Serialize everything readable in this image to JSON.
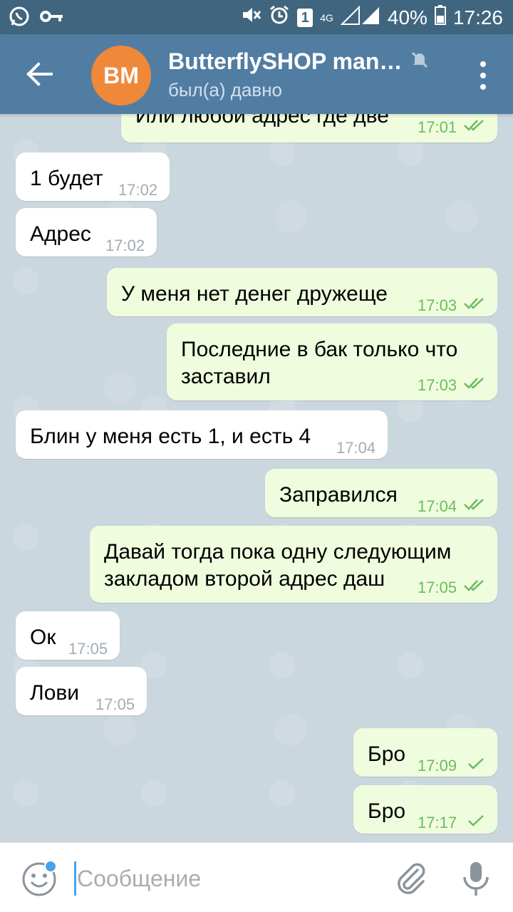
{
  "status_bar": {
    "battery": "40%",
    "time": "17:26",
    "sim_badge": "1",
    "network": "4G"
  },
  "header": {
    "avatar_initials": "BM",
    "title": "ButterflySHOP man…",
    "subtitle": "был(а) давно"
  },
  "messages": [
    {
      "side": "out",
      "text": "Или любой адрес где две",
      "time": "17:01",
      "status": "read"
    },
    {
      "side": "in",
      "text": "1 будет",
      "time": "17:02"
    },
    {
      "side": "in",
      "text": "Адрес",
      "time": "17:02"
    },
    {
      "side": "out",
      "text": "У меня нет денег дружеще",
      "time": "17:03",
      "status": "read"
    },
    {
      "side": "out",
      "line1": "Последние в бак только что",
      "line2": "заставил",
      "time": "17:03",
      "status": "read"
    },
    {
      "side": "in",
      "text": "Блин у меня есть 1, и есть 4",
      "time": "17:04"
    },
    {
      "side": "out",
      "text": "Заправился",
      "time": "17:04",
      "status": "read"
    },
    {
      "side": "out",
      "line1": "Давай тогда пока одну следующим",
      "line2": "закладом второй адрес даш",
      "time": "17:05",
      "status": "read"
    },
    {
      "side": "in",
      "text": "Ок",
      "time": "17:05"
    },
    {
      "side": "in",
      "text": "Лови",
      "time": "17:05"
    },
    {
      "side": "out",
      "text": "Бро",
      "time": "17:09",
      "status": "sent"
    },
    {
      "side": "out",
      "text": "Бро",
      "time": "17:17",
      "status": "sent"
    }
  ],
  "input": {
    "placeholder": "Сообщение"
  },
  "colors": {
    "header": "#527da3",
    "status_bar": "#40667f",
    "incoming_bubble": "#ffffff",
    "outgoing_bubble": "#effdde",
    "check_green": "#6cbb5d",
    "avatar": "#f0883a"
  },
  "icons": [
    "whatsapp-icon",
    "key-icon",
    "mute-icon",
    "alarm-icon",
    "signal-icon",
    "battery-icon",
    "back-arrow-icon",
    "muted-bell-icon",
    "more-vert-icon",
    "emoji-icon",
    "attach-icon",
    "mic-icon"
  ]
}
